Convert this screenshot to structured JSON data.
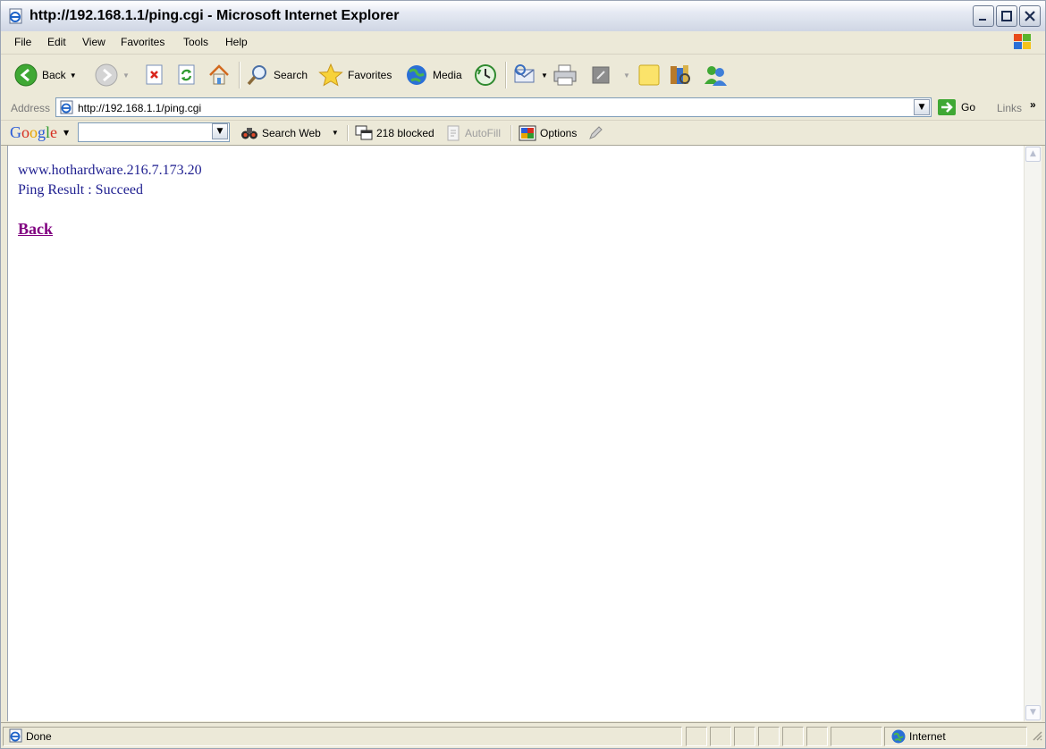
{
  "window": {
    "title": "http://192.168.1.1/ping.cgi - Microsoft Internet Explorer"
  },
  "menu": [
    "File",
    "Edit",
    "View",
    "Favorites",
    "Tools",
    "Help"
  ],
  "toolbar": {
    "back_label": "Back",
    "search_label": "Search",
    "favorites_label": "Favorites",
    "media_label": "Media"
  },
  "address": {
    "label": "Address",
    "url": "http://192.168.1.1/ping.cgi",
    "go_label": "Go",
    "links_label": "Links",
    "links_chevron": "»"
  },
  "google_toolbar": {
    "logo": "Google",
    "search_value": "",
    "search_web_label": "Search Web",
    "blocked_label": "218 blocked",
    "autofill_label": "AutoFill",
    "options_label": "Options"
  },
  "page": {
    "host_line": "www.hothardware.216.7.173.20",
    "result_line": "Ping Result : Succeed",
    "back_link": "Back"
  },
  "status": {
    "text": "Done",
    "zone": "Internet"
  },
  "colors": {
    "content_text": "#1f1f90",
    "visited_link": "#800080",
    "chrome_bg": "#ece9d8"
  }
}
